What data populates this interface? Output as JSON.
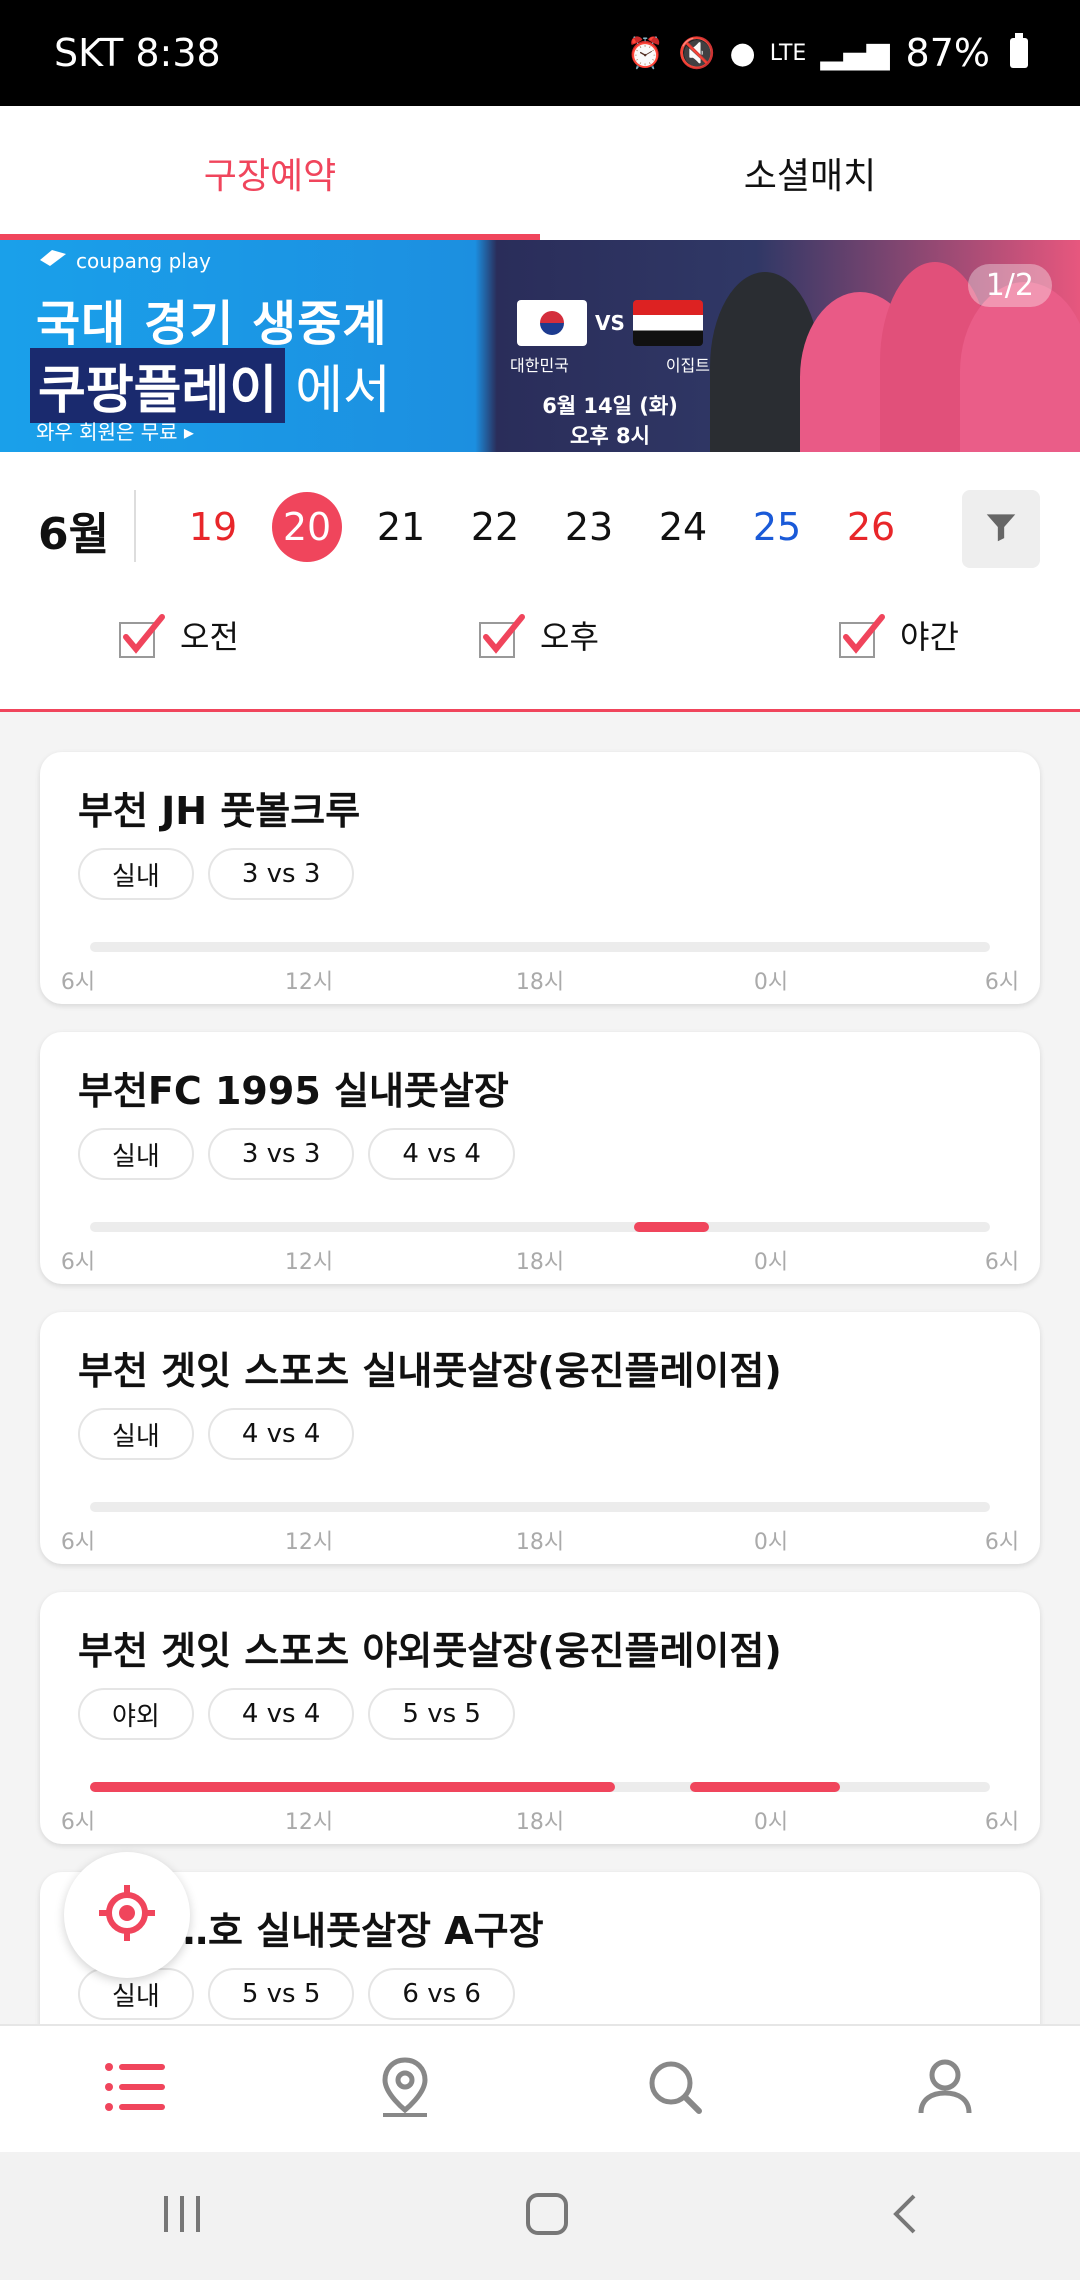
{
  "status_bar": {
    "carrier_time": "SKT 8:38",
    "network": "LTE",
    "battery": "87%"
  },
  "tabs": [
    {
      "label": "구장예약",
      "active": true
    },
    {
      "label": "소셜매치",
      "active": false
    }
  ],
  "banner": {
    "brand": "coupang play",
    "line1": "국대 경기 생중계",
    "line2_highlight": "쿠팡플레이",
    "line2_rest": "에서",
    "subtext": "와우 회원은 무료 ▸",
    "team_home": "대한민국",
    "vs": "VS",
    "team_away": "이집트",
    "date": "6월 14일 (화)",
    "time": "오후 8시",
    "pager": "1/2"
  },
  "date_selector": {
    "month": "6월",
    "days": [
      {
        "label": "19",
        "color": "red",
        "selected": false
      },
      {
        "label": "20",
        "color": "red",
        "selected": true
      },
      {
        "label": "21",
        "color": "default",
        "selected": false
      },
      {
        "label": "22",
        "color": "default",
        "selected": false
      },
      {
        "label": "23",
        "color": "default",
        "selected": false
      },
      {
        "label": "24",
        "color": "default",
        "selected": false
      },
      {
        "label": "25",
        "color": "blue",
        "selected": false
      },
      {
        "label": "26",
        "color": "red",
        "selected": false
      }
    ],
    "time_filters": [
      {
        "label": "오전",
        "checked": true
      },
      {
        "label": "오후",
        "checked": true
      },
      {
        "label": "야간",
        "checked": true
      }
    ]
  },
  "timeline_ticks": [
    "6시",
    "12시",
    "18시",
    "0시",
    "6시"
  ],
  "venues": [
    {
      "name": "부천 JH 풋볼크루",
      "tags": [
        "실내",
        "3 vs 3"
      ],
      "available": []
    },
    {
      "name": "부천FC 1995 실내풋살장",
      "tags": [
        "실내",
        "3 vs 3",
        "4 vs 4"
      ],
      "available": [
        [
          20.5,
          22.5
        ]
      ]
    },
    {
      "name": "부천 겟잇 스포츠 실내풋살장(웅진플레이점)",
      "tags": [
        "실내",
        "4 vs 4"
      ],
      "available": []
    },
    {
      "name": "부천 겟잇 스포츠 야외풋살장(웅진플레이점)",
      "tags": [
        "야외",
        "4 vs 4",
        "5 vs 5"
      ],
      "available": [
        [
          6,
          20
        ],
        [
          22,
          26
        ]
      ]
    },
    {
      "name": "…호 실내풋살장 A구장",
      "tags": [
        "실내",
        "5 vs 5",
        "6 vs 6"
      ],
      "available": []
    }
  ],
  "bottom_nav": [
    "list-icon",
    "map-pin-icon",
    "search-icon",
    "profile-icon"
  ],
  "colors": {
    "accent": "#f0455c",
    "weekend_red": "#e8262a",
    "saturday_blue": "#1a5ad8"
  }
}
